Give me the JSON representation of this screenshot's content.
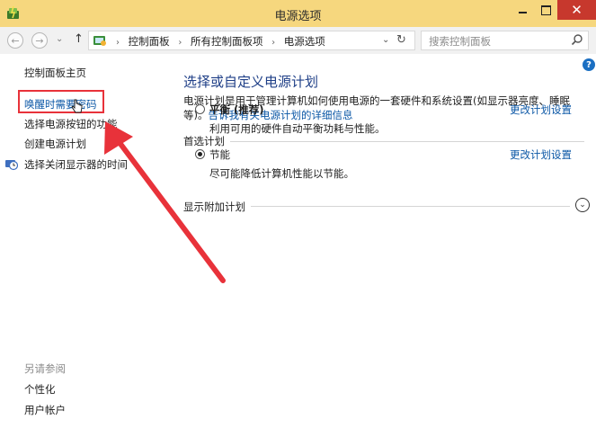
{
  "window": {
    "title": "电源选项",
    "close_label": "✕"
  },
  "address": {
    "crumbs": [
      "控制面板",
      "所有控制面板项",
      "电源选项"
    ],
    "separator": "›",
    "search_placeholder": "搜索控制面板"
  },
  "sidebar": {
    "home": "控制面板主页",
    "items": [
      {
        "label": "唤醒时需要密码"
      },
      {
        "label": "选择电源按钮的功能"
      },
      {
        "label": "创建电源计划"
      },
      {
        "label": "选择关闭显示器的时间"
      }
    ],
    "see_also_title": "另请参阅",
    "see_also": [
      {
        "label": "个性化"
      },
      {
        "label": "用户帐户"
      }
    ]
  },
  "main": {
    "heading": "选择或自定义电源计划",
    "description": "电源计划是用于管理计算机如何使用电源的一套硬件和系统设置(如显示器亮度、睡眠等)。",
    "description_link": "告诉我有关电源计划的详细信息",
    "preferred_label": "首选计划",
    "plans": [
      {
        "name": "平衡 (推荐)",
        "desc": "利用可用的硬件自动平衡功耗与性能。",
        "change": "更改计划设置",
        "selected": false
      },
      {
        "name": "节能",
        "desc": "尽可能降低计算机性能以节能。",
        "change": "更改计划设置",
        "selected": true
      }
    ],
    "more_label": "显示附加计划"
  },
  "colors": {
    "titlebar": "#f6d77e",
    "accent_link": "#0b57a6",
    "heading": "#1f3f87",
    "annotation": "#e8323a",
    "close": "#c7382d"
  }
}
